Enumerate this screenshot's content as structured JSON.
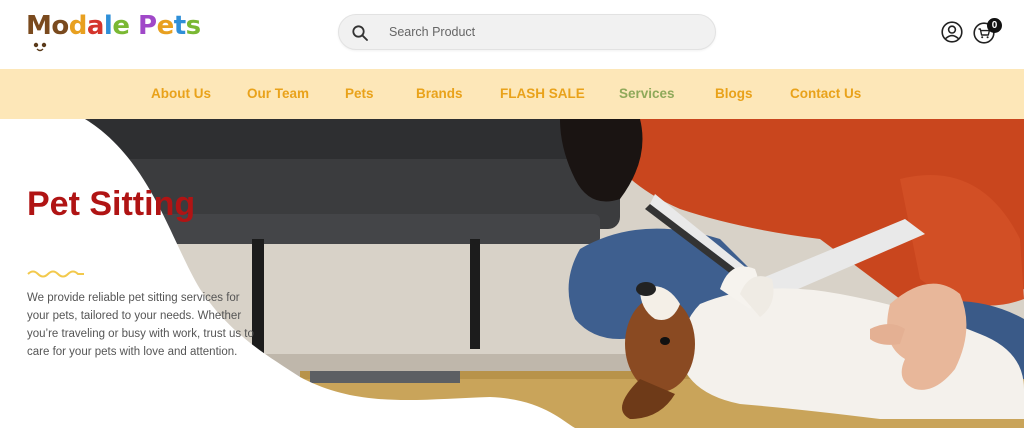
{
  "logo": {
    "text_parts": [
      "Mo",
      "d",
      "a",
      "l",
      "e",
      " P",
      "e",
      "t",
      "s"
    ]
  },
  "search": {
    "placeholder": "Search Product"
  },
  "header": {
    "cart_count": "0"
  },
  "nav": {
    "items": [
      {
        "label": "About Us"
      },
      {
        "label": "Our Team"
      },
      {
        "label": "Pets"
      },
      {
        "label": "Brands"
      },
      {
        "label": "FLASH SALE"
      },
      {
        "label": "Services"
      },
      {
        "label": "Blogs"
      },
      {
        "label": "Contact Us"
      }
    ]
  },
  "hero": {
    "title": "Pet Sitting",
    "description": "We provide reliable pet sitting services for your pets, tailored to your needs. Whether you’re traveling or busy with work, trust us to care for your pets with love and attention."
  },
  "colors": {
    "nav_bg": "#fde7b8",
    "nav_text": "#e9a21a",
    "nav_active": "#8fa95a",
    "hero_title": "#b01414"
  }
}
